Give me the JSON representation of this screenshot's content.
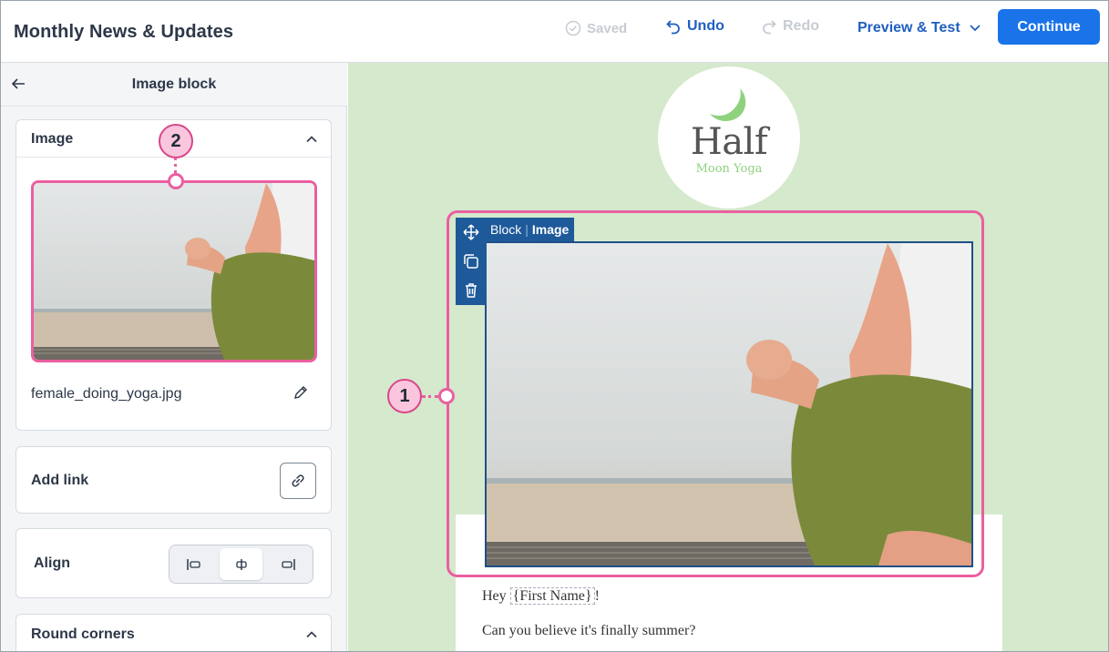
{
  "header": {
    "title": "Monthly News & Updates",
    "saved_label": "Saved",
    "undo_label": "Undo",
    "redo_label": "Redo",
    "preview_label": "Preview & Test",
    "continue_label": "Continue"
  },
  "sidebar": {
    "title": "Image block",
    "image_section": {
      "label": "Image",
      "filename": "female_doing_yoga.jpg"
    },
    "add_link_label": "Add link",
    "align_label": "Align",
    "align_options": [
      "left",
      "center",
      "right"
    ],
    "align_selected": "center",
    "round_corners_label": "Round corners"
  },
  "canvas": {
    "logo": {
      "line1": "Half",
      "line2": "Moon Yoga"
    },
    "block_tag": {
      "kind": "Block",
      "type": "Image"
    },
    "greeting_prefix": "Hey ",
    "greeting_token": "{First Name}",
    "greeting_suffix": "!",
    "paragraph": "Can you believe it's finally summer?"
  },
  "callouts": {
    "one": "1",
    "two": "2"
  },
  "colors": {
    "accent": "#1a73e8",
    "highlight": "#ea5fa0",
    "canvas_bg": "#d5e9cc",
    "logo_green": "#8fd27e"
  }
}
